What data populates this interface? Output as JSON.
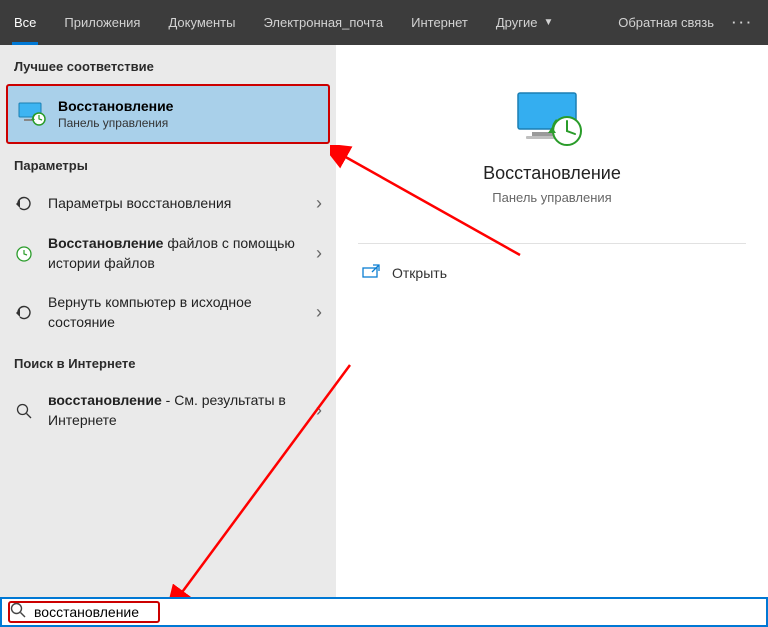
{
  "topbar": {
    "tabs": [
      "Все",
      "Приложения",
      "Документы",
      "Электронная_почта",
      "Интернет",
      "Другие"
    ],
    "activeIndex": 0,
    "feedback": "Обратная связь"
  },
  "sections": {
    "best": "Лучшее соответствие",
    "params": "Параметры",
    "web": "Поиск в Интернете"
  },
  "hero": {
    "title": "Восстановление",
    "sub": "Панель управления"
  },
  "params_items": {
    "p0": "Параметры восстановления",
    "p1_bold": "Восстановление",
    "p1_rest": " файлов с помощью истории файлов",
    "p2": "Вернуть компьютер в исходное состояние"
  },
  "web_item": {
    "bold": "восстановление",
    "rest": " - См. результаты в Интернете"
  },
  "preview": {
    "title": "Восстановление",
    "sub": "Панель управления",
    "open": "Открыть"
  },
  "search": {
    "value": "восстановление"
  }
}
